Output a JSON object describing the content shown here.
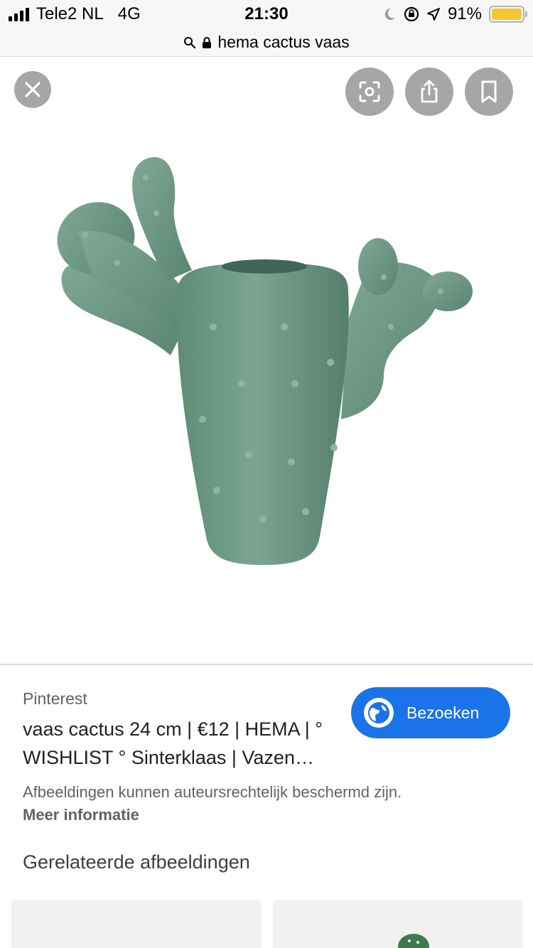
{
  "status_bar": {
    "carrier": "Tele2 NL",
    "network": "4G",
    "time": "21:30",
    "battery": "91%",
    "battery_color": "#f7c733"
  },
  "url_bar": {
    "text": "hema cactus vaas",
    "icons": [
      "search-icon",
      "lock-icon"
    ]
  },
  "viewer": {
    "buttons": [
      "close-icon",
      "lens-icon",
      "share-icon",
      "bookmark-icon"
    ],
    "image_color": "#6f9a86"
  },
  "result": {
    "source": "Pinterest",
    "title": "vaas cactus 24 cm | €12 | HEMA | ° WISHLIST ° Sinterklaas | Vazen…",
    "visit_label": "Bezoeken",
    "copyright_note": "Afbeeldingen kunnen auteursrechtelijk beschermd zijn.",
    "more_info": "Meer informatie",
    "accent": "#1a73e8"
  },
  "related": {
    "heading": "Gerelateerde afbeeldingen"
  }
}
